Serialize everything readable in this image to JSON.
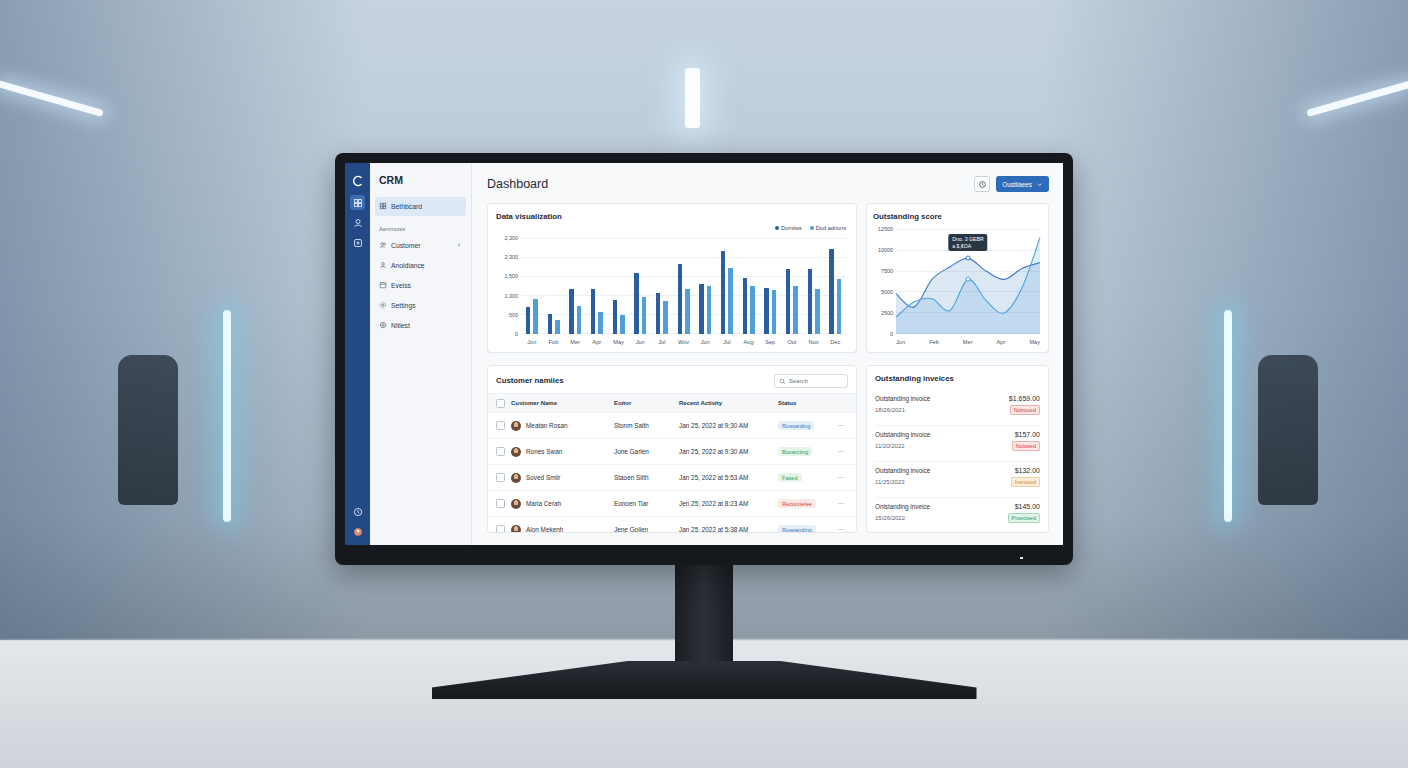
{
  "rail": [
    {
      "selected": true
    },
    {
      "selected": false
    },
    {
      "selected": false
    }
  ],
  "nav": {
    "brand": "CRM",
    "top_items": [
      {
        "label": "Bethbcard",
        "selected": true
      }
    ],
    "section_title": "Aenmoiss",
    "section_items": [
      {
        "label": "Customer",
        "selected": false,
        "expandable": true
      },
      {
        "label": "Anoidiance",
        "selected": false,
        "expandable": false
      },
      {
        "label": "Eveiss",
        "selected": false,
        "expandable": false
      },
      {
        "label": "Settings",
        "selected": false,
        "expandable": false
      },
      {
        "label": "Nitiest",
        "selected": false,
        "expandable": false
      }
    ]
  },
  "header": {
    "title": "Dashboard",
    "button": "Oustiiaees"
  },
  "bar_chart": {
    "title": "Data visualization",
    "y_ticks": [
      "2,300",
      "2,300",
      "1,500",
      "1,300",
      "500",
      "0"
    ],
    "axis_max": 2500,
    "x_labels": [
      "Jon",
      "Fob",
      "Mer",
      "Apr",
      "May",
      "Jun",
      "Jul",
      "Wov",
      "Jun",
      "Jul",
      "Aug",
      "Sep",
      "Oot",
      "Nov",
      "Dec"
    ],
    "series": [
      {
        "label": "Dornites",
        "color": "#2a5ea0",
        "values": [
          700,
          530,
          1170,
          1170,
          890,
          1580,
          1080,
          1830,
          1300,
          2170,
          1470,
          1190,
          1690,
          1690,
          2220
        ]
      },
      {
        "label": "Dod adrions",
        "color": "#4f9fd8",
        "values": [
          900,
          360,
          720,
          580,
          500,
          970,
          860,
          1170,
          1250,
          1720,
          1250,
          1140,
          1250,
          1170,
          1420
        ]
      }
    ]
  },
  "score_chart": {
    "title": "Outstanding score",
    "y_ticks": [
      "12500",
      "10000",
      "7500",
      "5000",
      "2500",
      "0"
    ],
    "axis_max": 12500,
    "x_labels": [
      "Jon",
      "Feb",
      "Mer",
      "Apr",
      "May"
    ],
    "series": [
      {
        "color": "#3f78c0",
        "values": [
          4800,
          3200,
          6500,
          8000,
          9000,
          7500,
          6500,
          7800,
          8500
        ]
      },
      {
        "color": "#4aa3e0",
        "values": [
          2000,
          3800,
          4200,
          2800,
          6500,
          4000,
          2500,
          5500,
          11500
        ]
      }
    ],
    "tooltip": {
      "lines": [
        "Dno. 3 GEBR",
        "a $,€OA"
      ],
      "point": 4
    }
  },
  "customers": {
    "title": "Customer namiies",
    "search_placeholder": "Search",
    "columns": [
      "Customer Name",
      "Eoitor",
      "Recent Activity",
      "Status"
    ],
    "header_checked": false,
    "menu_icon": "···",
    "rows": [
      {
        "name": "Meatan Rosan",
        "editor": "Stonm Saith",
        "activity": "Jan 25, 2022 at 9:30 AM",
        "status": "Rossarding",
        "color": "#2f7fc1",
        "checked": false
      },
      {
        "name": "Rones Swan",
        "editor": "Jone Garlen",
        "activity": "Jan 25, 2022 at 9:30 AM",
        "status": "Bosarcting",
        "color": "#2e9e5b",
        "checked": false
      },
      {
        "name": "Soved Smilr",
        "editor": "Staoen Slith",
        "activity": "Jan 25, 2022 at 5:53 AM",
        "status": "Fased",
        "color": "#2e9e5b",
        "checked": false
      },
      {
        "name": "Maria Cerah",
        "editor": "Eonoen Tiar",
        "activity": "Jen 25, 2022 at 8:23 AM",
        "status": "Reconnelee",
        "color": "#d0453f",
        "checked": false
      },
      {
        "name": "Alon Mekenh",
        "editor": "Jene Goilen",
        "activity": "Jan 25, 2022 at 5:38 AM",
        "status": "Roseanding",
        "color": "#2f7fc1",
        "checked": false
      }
    ]
  },
  "invoices": {
    "title": "Outstanding inveices",
    "items": [
      {
        "label": "Outstanding invoice",
        "date": "18/26/2021",
        "amount": "$1,659.00",
        "status": "Noiroued",
        "color": "#d0453f"
      },
      {
        "label": "Outstanding invoice",
        "date": "11/20/2022",
        "amount": "$157.00",
        "status": "Noiosed",
        "color": "#d0453f"
      },
      {
        "label": "Outstanding invoice",
        "date": "11/25/2023",
        "amount": "$132.00",
        "status": "Inerased",
        "color": "#d98a1c"
      },
      {
        "label": "Onistanding inveice",
        "date": "15/26/2022",
        "amount": "$145.00",
        "status": "Proecised",
        "color": "#2e9e5b"
      }
    ]
  }
}
